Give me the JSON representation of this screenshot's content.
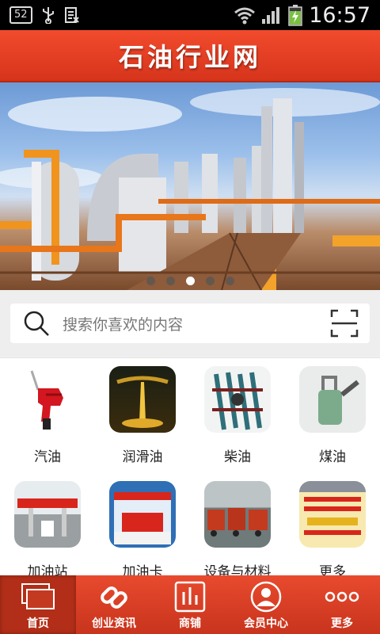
{
  "status_bar": {
    "badge": "52",
    "time": "16:57"
  },
  "header": {
    "title": "石油行业网"
  },
  "banner": {
    "slide_count": 5,
    "active_slide": 3
  },
  "search": {
    "placeholder": "搜索你喜欢的内容"
  },
  "categories": [
    {
      "label": "汽油",
      "icon": "fuel-nozzle"
    },
    {
      "label": "润滑油",
      "icon": "lubricant-pour"
    },
    {
      "label": "柴油",
      "icon": "diesel-engine"
    },
    {
      "label": "煤油",
      "icon": "kerosene-torch"
    },
    {
      "label": "加油站",
      "icon": "gas-station"
    },
    {
      "label": "加油卡",
      "icon": "fuel-card"
    },
    {
      "label": "设备与材料",
      "icon": "trucks"
    },
    {
      "label": "更多",
      "icon": "poster"
    }
  ],
  "tabbar": {
    "items": [
      {
        "label": "首页",
        "icon": "home-icon",
        "active": true
      },
      {
        "label": "创业资讯",
        "icon": "link-icon",
        "active": false
      },
      {
        "label": "商铺",
        "icon": "chart-icon",
        "active": false
      },
      {
        "label": "会员中心",
        "icon": "user-icon",
        "active": false
      },
      {
        "label": "更多",
        "icon": "more-dots-icon",
        "active": false
      }
    ]
  },
  "colors": {
    "brand_red": "#e8452a",
    "status_bar": "#000000"
  }
}
